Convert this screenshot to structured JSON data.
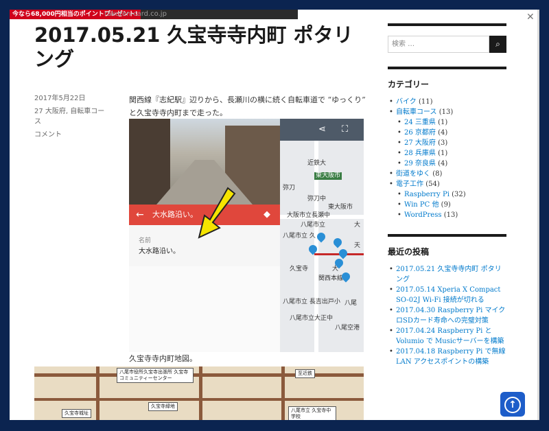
{
  "topbar": {
    "promo": "今なら68,000円相当のポイントプレゼント!",
    "url": "rakuten-card.co.jp"
  },
  "post": {
    "title": "2017.05.21 久宝寺寺内町 ポタリング",
    "date": "2017年5月22日",
    "categories": "27 大阪府, 自転車コース",
    "comment": "コメント",
    "intro": "関西線『志紀駅』辺りから、長瀬川の横に続く自転車道で “ゆっくり” と久宝寺寺内町まで走った。",
    "caption": "久宝寺寺内町地図。"
  },
  "screenshot": {
    "place_title": "大水路沿い。",
    "field_label": "名前",
    "field_value": "大水路沿い。",
    "map_labels": [
      "近鉄大",
      "東大阪市",
      "弥刀",
      "弥刀中",
      "東大阪市",
      "八尾市立",
      "大阪市立長瀬中",
      "大",
      "八尾市立 久",
      "天",
      "久宝寺",
      "関西本線",
      "大",
      "八尾市立 長吉出戸小",
      "八尾",
      "八尾市立大正中",
      "八尾空港"
    ]
  },
  "map2": {
    "labels": [
      "八尾市役所久宝寺出張所 久宝寺コミュニティーセンター",
      "至近鉄",
      "久宝寺緑地",
      "八尾市立 久宝寺中学校",
      "久宝寺城址"
    ]
  },
  "sidebar": {
    "search_placeholder": "検索 …",
    "search_icon": "search-icon",
    "cat_title": "カテゴリー",
    "categories": [
      {
        "label": "バイク",
        "count": "(11)"
      },
      {
        "label": "自転車コース",
        "count": "(13)"
      },
      {
        "label": "24 三重県",
        "count": "(1)",
        "sub": true
      },
      {
        "label": "26 京都府",
        "count": "(4)",
        "sub": true
      },
      {
        "label": "27 大阪府",
        "count": "(3)",
        "sub": true
      },
      {
        "label": "28 兵庫県",
        "count": "(1)",
        "sub": true
      },
      {
        "label": "29 奈良県",
        "count": "(4)",
        "sub": true
      },
      {
        "label": "街道をゆく",
        "count": "(8)"
      },
      {
        "label": "電子工作",
        "count": "(54)"
      },
      {
        "label": "Raspberry Pi",
        "count": "(32)",
        "sub": true
      },
      {
        "label": "Win PC 他",
        "count": "(9)",
        "sub": true
      },
      {
        "label": "WordPress",
        "count": "(13)",
        "sub": true
      }
    ],
    "recent_title": "最近の投稿",
    "recent": [
      "2017.05.21 久宝寺寺内町 ポタリング",
      "2017.05.14 Xperia X Compact SO-02J Wi-Fi 接続が切れる",
      "2017.04.30 Raspberry Pi マイクロSDカード寿命への完璧対策",
      "2017.04.24 Raspberry Pi と Volumio で Musicサーバーを構築",
      "2017.04.18 Raspberry Pi で無線LAN アクセスポイントの構築"
    ]
  },
  "colors": {
    "accent": "#007acc",
    "frame": "#0b2450",
    "red": "#e0473c",
    "top_button": "#1d5dc9"
  }
}
